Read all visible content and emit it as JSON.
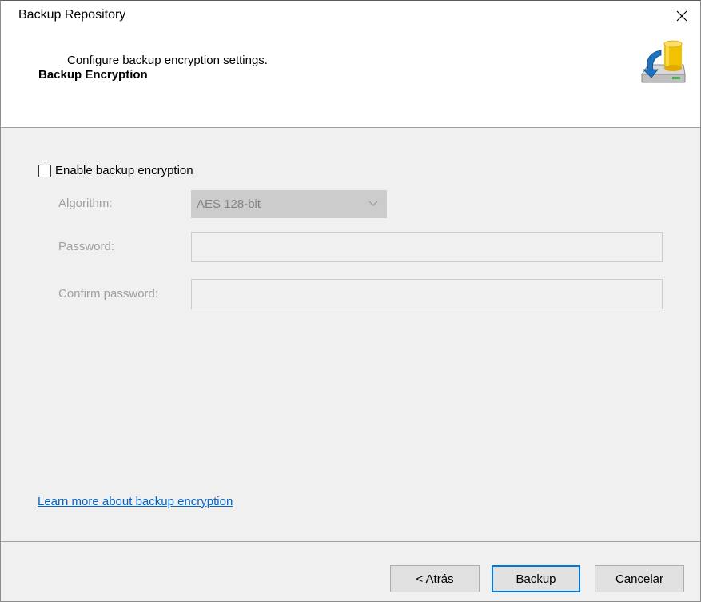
{
  "window": {
    "title": "Backup Repository"
  },
  "header": {
    "title": "Backup Encryption",
    "subtitle": "Configure backup encryption settings.",
    "icon": "backup-database-icon"
  },
  "form": {
    "enable_label": "Enable backup encryption",
    "enable_checked": false,
    "algorithm_label": "Algorithm:",
    "algorithm_value": "AES 128-bit",
    "password_label": "Password:",
    "password_value": "",
    "confirm_label": "Confirm password:",
    "confirm_value": ""
  },
  "link": {
    "text": "Learn more about backup encryption"
  },
  "buttons": {
    "back": "< Atrás",
    "backup": "Backup",
    "cancel": "Cancelar"
  },
  "colors": {
    "accent": "#0078d7",
    "link": "#0066cc",
    "disabled_text": "#a0a0a0"
  }
}
